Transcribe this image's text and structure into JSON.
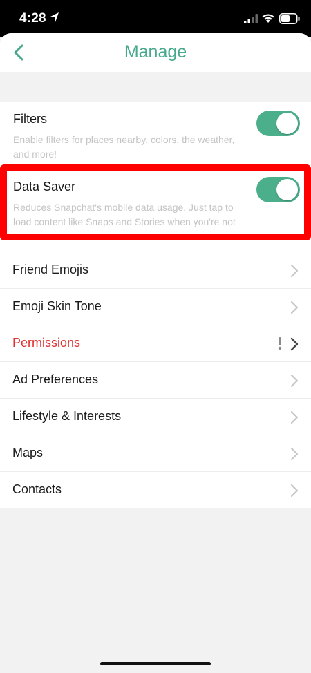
{
  "status_bar": {
    "time": "4:28"
  },
  "header": {
    "title": "Manage"
  },
  "toggles": [
    {
      "title": "Filters",
      "description": "Enable filters for places nearby, colors, the weather, and more!",
      "enabled": true
    },
    {
      "title": "Data Saver",
      "description": "Reduces Snapchat's mobile data usage. Just tap to load content like Snaps and Stories when you're not",
      "enabled": true
    }
  ],
  "nav_items": [
    {
      "label": "Friend Emojis"
    },
    {
      "label": "Emoji Skin Tone"
    },
    {
      "label": "Permissions"
    },
    {
      "label": "Ad Preferences"
    },
    {
      "label": "Lifestyle & Interests"
    },
    {
      "label": "Maps"
    },
    {
      "label": "Contacts"
    }
  ],
  "colors": {
    "accent": "#46a98b",
    "toggle_on": "#4caf8b",
    "warning_text": "#e0302f",
    "highlight": "#ff0000"
  },
  "icons": {
    "back": "chevron-left-icon",
    "row": "chevron-right-icon",
    "alert": "exclamation-icon"
  }
}
